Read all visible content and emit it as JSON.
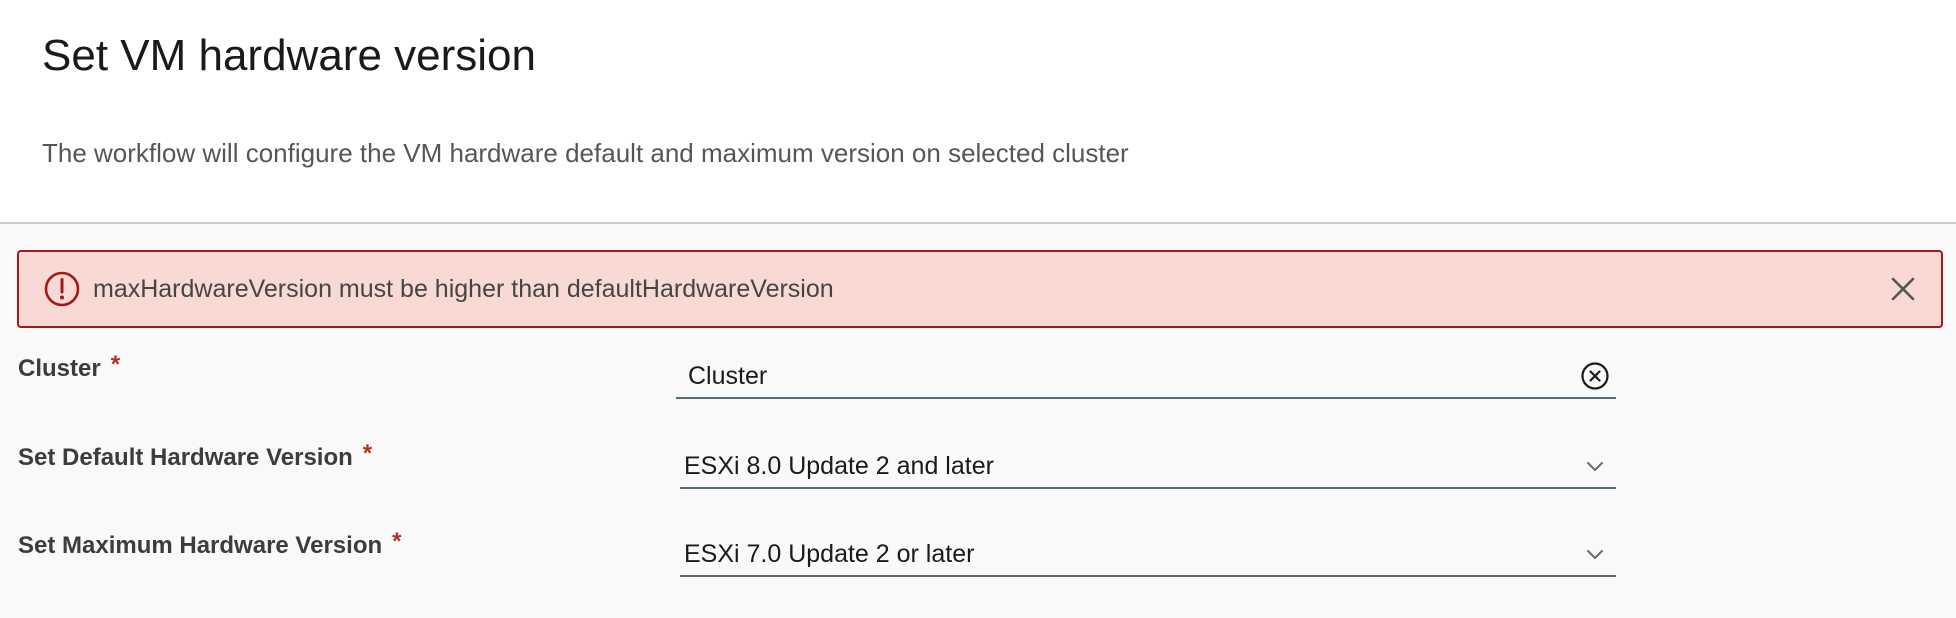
{
  "header": {
    "title": "Set VM hardware version",
    "description": "The workflow will configure the VM hardware default and maximum version on selected cluster"
  },
  "alert": {
    "message": "maxHardwareVersion must be higher than defaultHardwareVersion",
    "icon": "exclamation-circle-icon",
    "close_icon": "close-icon",
    "colors": {
      "background": "#f8d9d3",
      "border": "#a3191a",
      "icon": "#a3191a"
    }
  },
  "form": {
    "required_marker": "*",
    "cluster": {
      "label": "Cluster",
      "value": "Cluster",
      "icon": "clear-circle-icon"
    },
    "default_version": {
      "label": "Set Default Hardware Version",
      "value": "ESXi 8.0 Update 2 and later",
      "icon": "chevron-down-icon"
    },
    "max_version": {
      "label": "Set Maximum Hardware Version",
      "value": "ESXi 7.0 Update 2 or later",
      "icon": "chevron-down-icon"
    }
  }
}
